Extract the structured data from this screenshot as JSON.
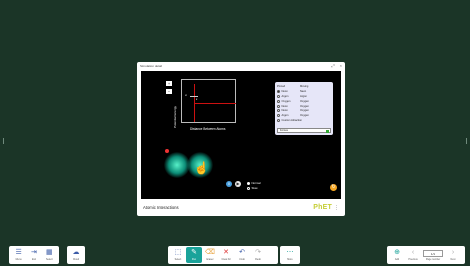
{
  "popup": {
    "title": "Simulation detail",
    "footer_title": "Atomic Interactions",
    "brand": "PhET"
  },
  "sim": {
    "y_axis": "Potential Energy",
    "x_axis": "Distance Between Atoms",
    "markers": [
      "σ",
      "ε"
    ],
    "atoms": [
      {
        "left": "Neon",
        "right": "Neon"
      },
      {
        "left": "Argon",
        "right": "Argon"
      },
      {
        "left": "Oxygen",
        "right": "Oxygen"
      },
      {
        "left": "Neon",
        "right": "Oxygen"
      },
      {
        "left": "Neon",
        "right": "Oxygen"
      },
      {
        "left": "Argon",
        "right": "Oxygen"
      },
      {
        "left": "Custom Attraction",
        "right": ""
      }
    ],
    "headers": {
      "left": "Pinned",
      "right": "Moving"
    },
    "forces_button": "Forces",
    "speed": {
      "normal": "Normal",
      "slow": "Slow"
    }
  },
  "toolbar_left": [
    {
      "icon": "menu-icon",
      "label": "Menu",
      "glyph": "☰"
    },
    {
      "icon": "exit-icon",
      "label": "Exit",
      "glyph": "⇥"
    },
    {
      "icon": "grid-icon",
      "label": "Select",
      "glyph": "▦"
    }
  ],
  "toolbar_cloud": {
    "label": "Cloud",
    "glyph": "☁"
  },
  "toolbar_center": [
    {
      "icon": "select-icon",
      "label": "Select",
      "glyph": "⬚"
    },
    {
      "icon": "pen-icon",
      "label": "Pen",
      "glyph": "✎",
      "active": true
    },
    {
      "icon": "eraser-icon",
      "label": "Eraser",
      "glyph": "⌫"
    },
    {
      "icon": "clear-icon",
      "label": "Clear All",
      "glyph": "✕"
    },
    {
      "icon": "undo-icon",
      "label": "Undo",
      "glyph": "↶"
    },
    {
      "icon": "redo-icon",
      "label": "Redo",
      "glyph": "↷"
    }
  ],
  "toolbar_more": {
    "label": "More",
    "glyph": "⋯"
  },
  "toolbar_right": {
    "add": "Add",
    "previous": "Previous",
    "page": "1/1",
    "page_label": "Page number",
    "next": "Next"
  }
}
